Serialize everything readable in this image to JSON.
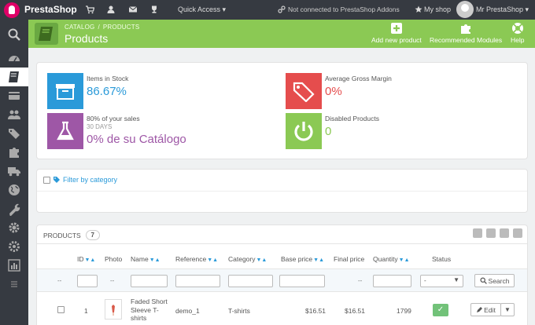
{
  "topbar": {
    "brand": "PrestaShop",
    "quick_access": "Quick Access ▾",
    "addons_status": "Not connected to PrestaShop Addons",
    "my_shop": "My shop",
    "user_name": "Mr PrestaShop ▾"
  },
  "header": {
    "breadcrumb": [
      "CATALOG",
      "PRODUCTS"
    ],
    "title": "Products",
    "buttons": {
      "add_new": "Add new product",
      "recommended": "Recommended Modules",
      "help": "Help"
    }
  },
  "kpis": {
    "items_in_stock": {
      "label": "Items in Stock",
      "value": "86.67%",
      "color": "#2a9ad9"
    },
    "gross_margin": {
      "label": "Average Gross Margin",
      "value": "0%",
      "color": "#e54d4d"
    },
    "sales": {
      "label": "80% of your sales",
      "sub": "30 DAYS",
      "value": "0% de su Catálogo",
      "color": "#9e57a6"
    },
    "disabled": {
      "label": "Disabled Products",
      "value": "0",
      "color": "#8bc954"
    }
  },
  "filter": {
    "label": "Filter by category"
  },
  "products": {
    "title": "PRODUCTS",
    "count": "7",
    "columns": {
      "id": "ID",
      "photo": "Photo",
      "name": "Name",
      "reference": "Reference",
      "category": "Category",
      "base_price": "Base price",
      "final_price": "Final price",
      "quantity": "Quantity",
      "status": "Status"
    },
    "filter_row": {
      "dash": "--",
      "status_select": "-",
      "search_button": "Search"
    },
    "rows": [
      {
        "id": "1",
        "name_lines": [
          "Faded Short",
          "Sleeve T-",
          "shirts"
        ],
        "reference": "demo_1",
        "category": "T-shirts",
        "base_price": "$16.51",
        "final_price": "$16.51",
        "quantity": "1799",
        "status": "✓",
        "edit": "Edit"
      }
    ]
  },
  "colors": {
    "topbar": "#363a41",
    "header": "#8bc954",
    "accent_blue": "#2a9ad9",
    "accent_red": "#e54d4d",
    "accent_purple": "#9e57a6",
    "accent_green": "#8bc954"
  }
}
